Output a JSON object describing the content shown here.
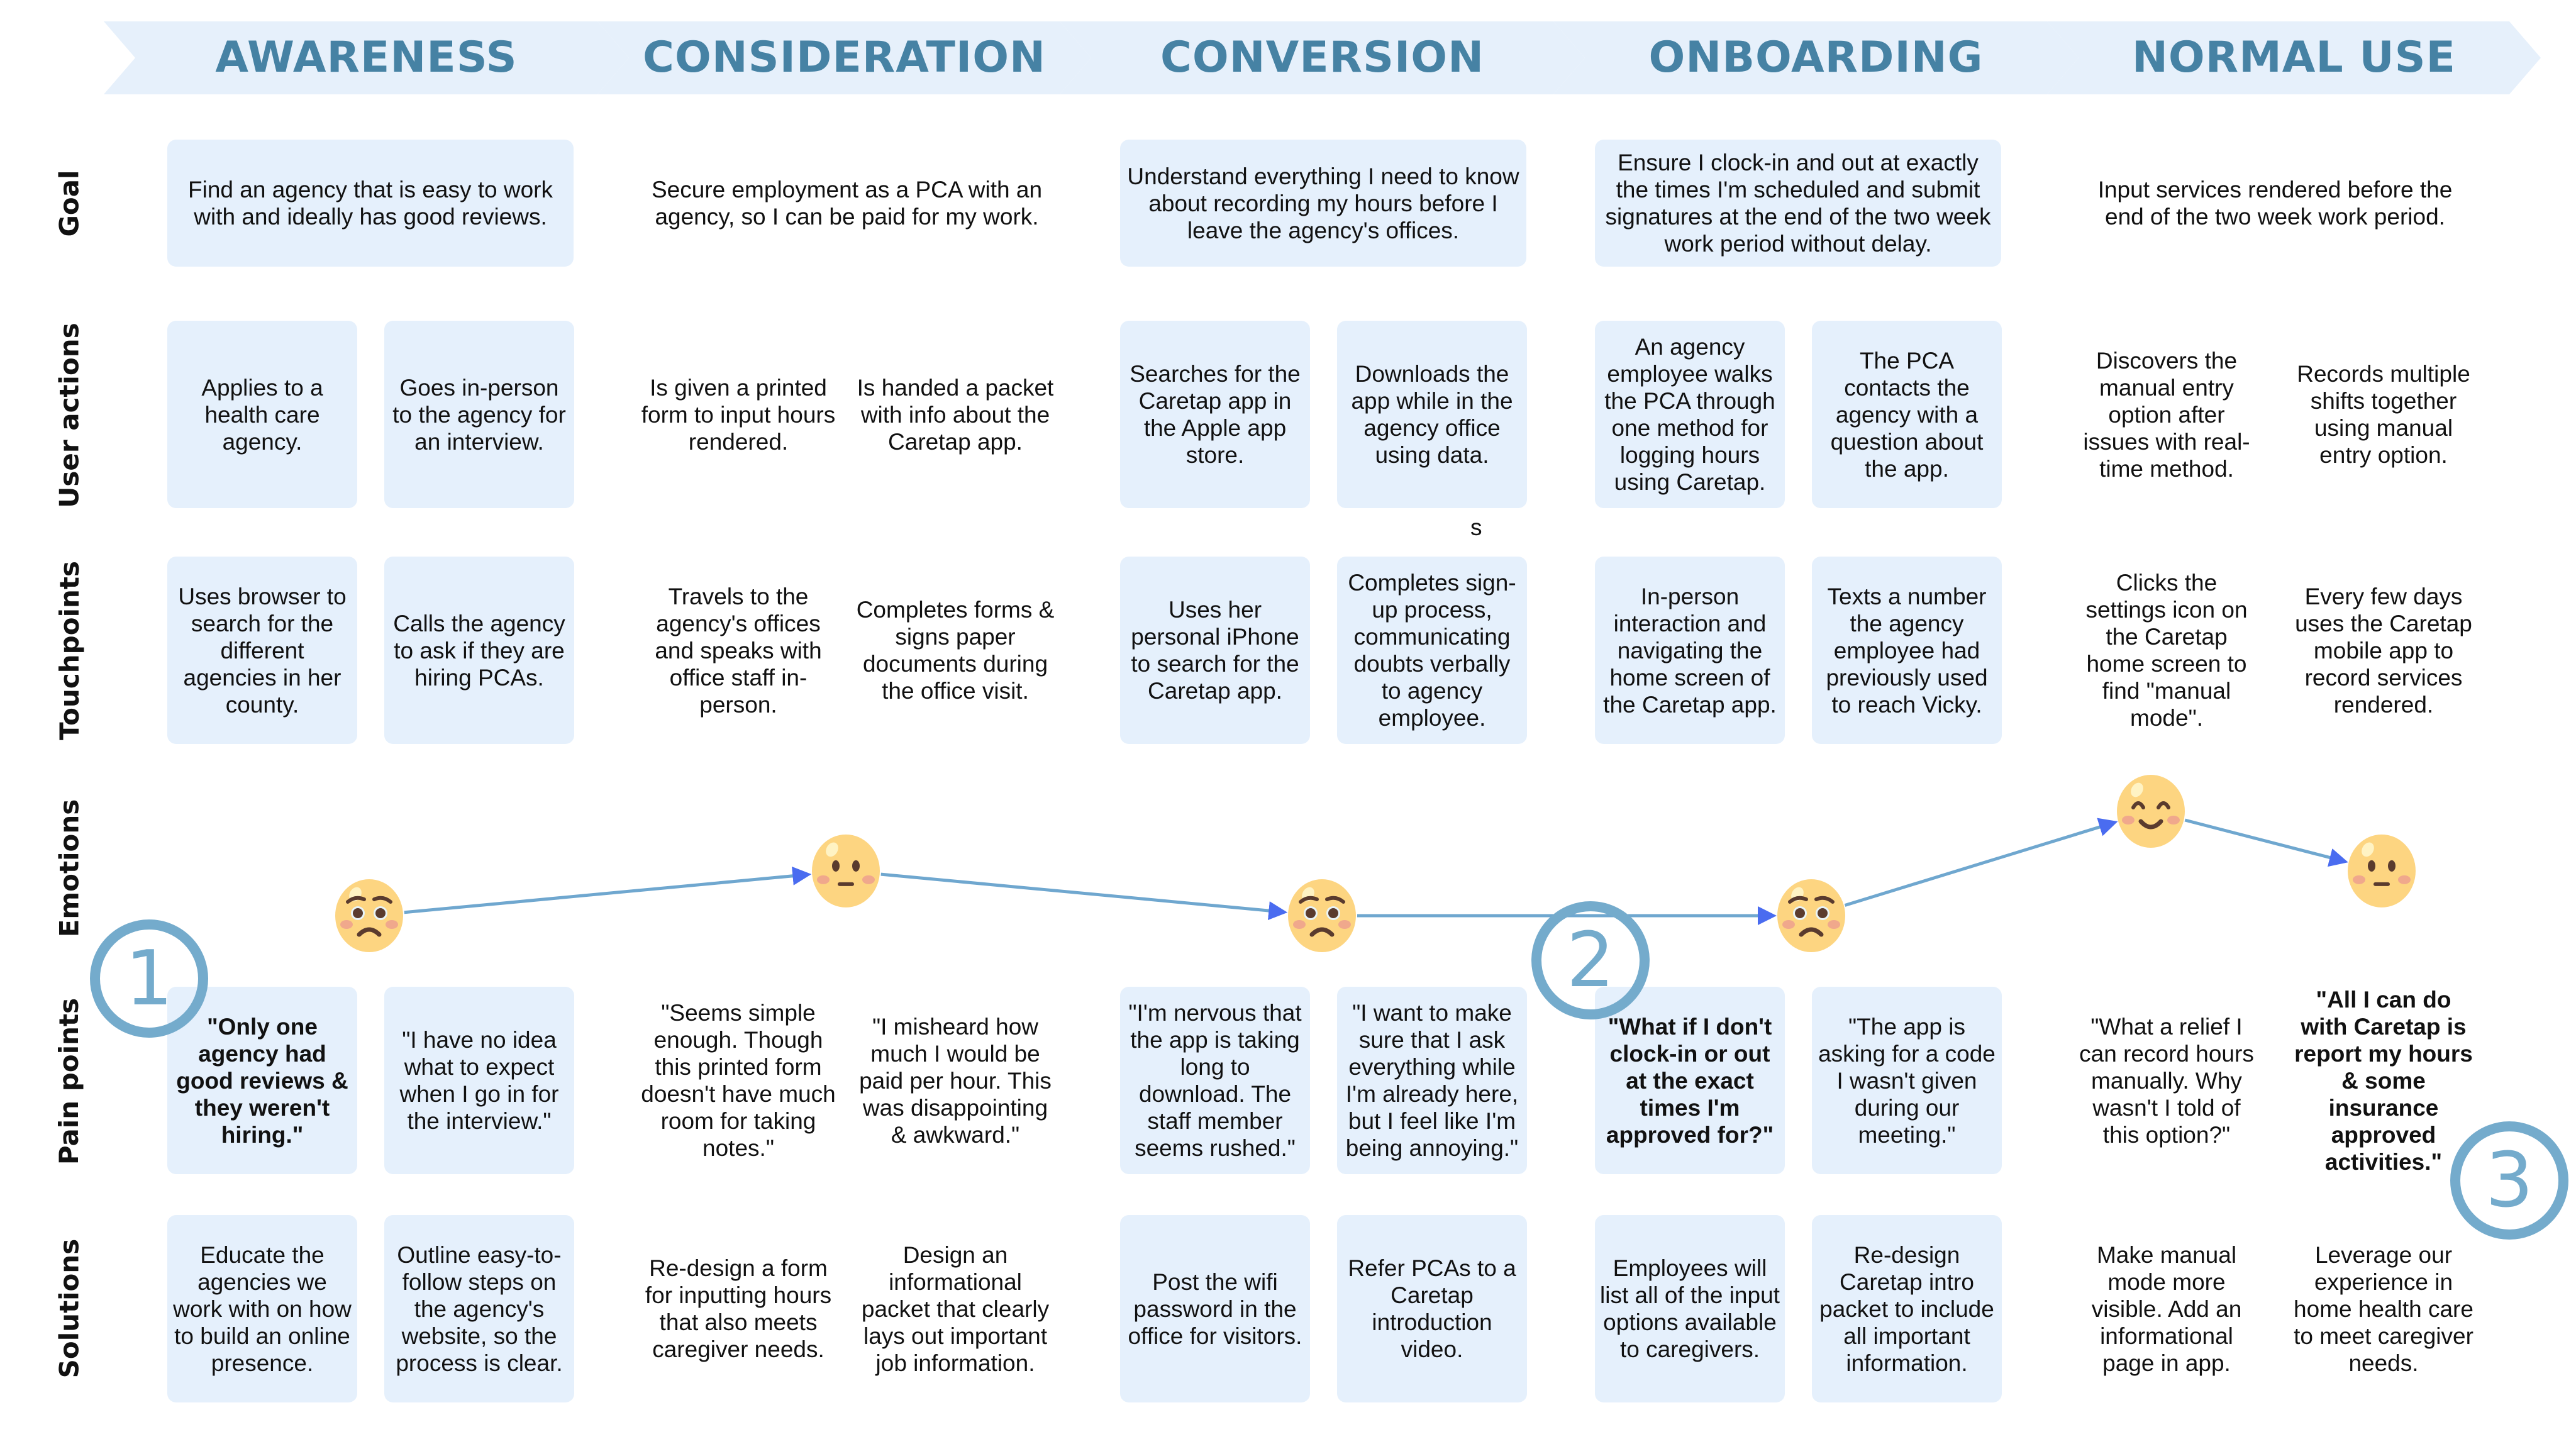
{
  "stages": [
    {
      "id": "awareness",
      "title": "AWARENESS"
    },
    {
      "id": "consideration",
      "title": "CONSIDERATION"
    },
    {
      "id": "conversion",
      "title": "CONVERSION"
    },
    {
      "id": "onboarding",
      "title": "ONBOARDING"
    },
    {
      "id": "normal-use",
      "title": "NORMAL USE"
    }
  ],
  "row_labels": {
    "goal": "Goal",
    "user_actions": "User actions",
    "touchpoints": "Touchpoints",
    "emotions": "Emotions",
    "pain_points": "Pain points",
    "solutions": "Solutions"
  },
  "goals": [
    "Find an agency that is easy to work with and ideally has good reviews.",
    "Secure employment as a PCA with an agency, so I can be paid for my work.",
    "Understand everything I need to know about recording my hours before I leave the agency's offices.",
    "Ensure I clock-in and out at exactly the times I'm scheduled and submit signatures at the end of the two week work period without delay.",
    "Input services rendered before the end of the two week work period."
  ],
  "user_actions": [
    [
      "Applies to a health care agency.",
      "Goes in-person to the agency for an interview."
    ],
    [
      "Is given a printed form to input hours rendered.",
      "Is handed a packet with info about the Caretap app."
    ],
    [
      "Searches for the Caretap app in the Apple app store.",
      "Downloads the app while in the agency office using data."
    ],
    [
      "An agency employee walks the PCA through one method for logging hours using Caretap.",
      "The PCA contacts the agency with a question about the app."
    ],
    [
      "Discovers the manual entry option after issues with real-time method.",
      "Records multiple shifts together using manual entry option."
    ]
  ],
  "stray_text": "s",
  "touchpoints": [
    [
      "Uses browser to search for the different agencies in her county.",
      "Calls the agency to ask if they are hiring PCAs."
    ],
    [
      "Travels to the agency's offices and speaks with office staff in-person.",
      "Completes forms & signs paper documents during the office visit."
    ],
    [
      "Uses her personal iPhone to search for the Caretap app.",
      "Completes sign-up process, communicating doubts verbally to agency employee."
    ],
    [
      "In-person interaction and navigating the home screen of the Caretap app.",
      "Texts a number the agency employee had previously used to reach Vicky."
    ],
    [
      "Clicks the settings icon on the Caretap home screen to find \"manual mode\".",
      "Every few days uses the Caretap mobile app to record services rendered."
    ]
  ],
  "emotions": [
    {
      "stage": "awareness",
      "face": "worried-face-icon",
      "level": 0.3
    },
    {
      "stage": "consideration",
      "face": "neutral-face-icon",
      "level": 0.6
    },
    {
      "stage": "conversion",
      "face": "worried-face-icon",
      "level": 0.3
    },
    {
      "stage": "onboarding",
      "face": "worried-face-icon",
      "level": 0.3
    },
    {
      "stage": "normal-use-1",
      "face": "happy-face-icon",
      "level": 1.0
    },
    {
      "stage": "normal-use-2",
      "face": "neutral-face-icon",
      "level": 0.6
    }
  ],
  "pain_points": [
    [
      {
        "text": "\"Only one agency had good reviews & they weren't hiring.\"",
        "bold": true
      },
      {
        "text": "\"I have no idea what to expect when I go in for the interview.\"",
        "bold": false
      }
    ],
    [
      {
        "text": "\"Seems simple enough. Though this printed form doesn't have much room for taking notes.\"",
        "bold": false
      },
      {
        "text": "\"I misheard how much I would be paid per hour. This was disappointing & awkward.\"",
        "bold": false
      }
    ],
    [
      {
        "text": "\"I'm nervous that the app is taking long to download. The staff member seems rushed.\"",
        "bold": false
      },
      {
        "text": "\"I want to make sure that I ask everything while I'm already here, but I feel like I'm being annoying.\"",
        "bold": false
      }
    ],
    [
      {
        "text": "\"What if I don't clock-in or out at the exact times I'm approved for?\"",
        "bold": true
      },
      {
        "text": "\"The app is asking for a code I wasn't given during our meeting.\"",
        "bold": false
      }
    ],
    [
      {
        "text": "\"What a relief I can record hours manually. Why wasn't I told of this option?\"",
        "bold": false
      },
      {
        "text": "\"All I can do with Caretap is report my hours & some insurance approved activities.\"",
        "bold": true
      }
    ]
  ],
  "solutions": [
    [
      "Educate the agencies we work with on how to build an online presence.",
      "Outline easy-to-follow steps on the agency's website, so the process is clear."
    ],
    [
      "Re-design a form for inputting hours that also meets caregiver needs.",
      "Design an informational packet that clearly lays out important job information."
    ],
    [
      "Post the wifi password in the office for visitors.",
      "Refer PCAs to a Caretap introduction video."
    ],
    [
      "Employees will list all of the input options available to caregivers.",
      "Re-design Caretap intro packet to include all important information."
    ],
    [
      "Make manual mode more visible. Add an informational page in app.",
      "Leverage our experience in home health care to meet caregiver needs."
    ]
  ],
  "badges": [
    "1",
    "2",
    "3"
  ],
  "colors": {
    "header_fill": "#e6f0fb",
    "header_text": "#4682a4",
    "card_blue": "#e5f0fc",
    "badge_ring": "#74abcc",
    "emotion_line": "#6fa7cf",
    "arrow_head": "#4a6cf0",
    "face_fill": "#fdd581"
  }
}
